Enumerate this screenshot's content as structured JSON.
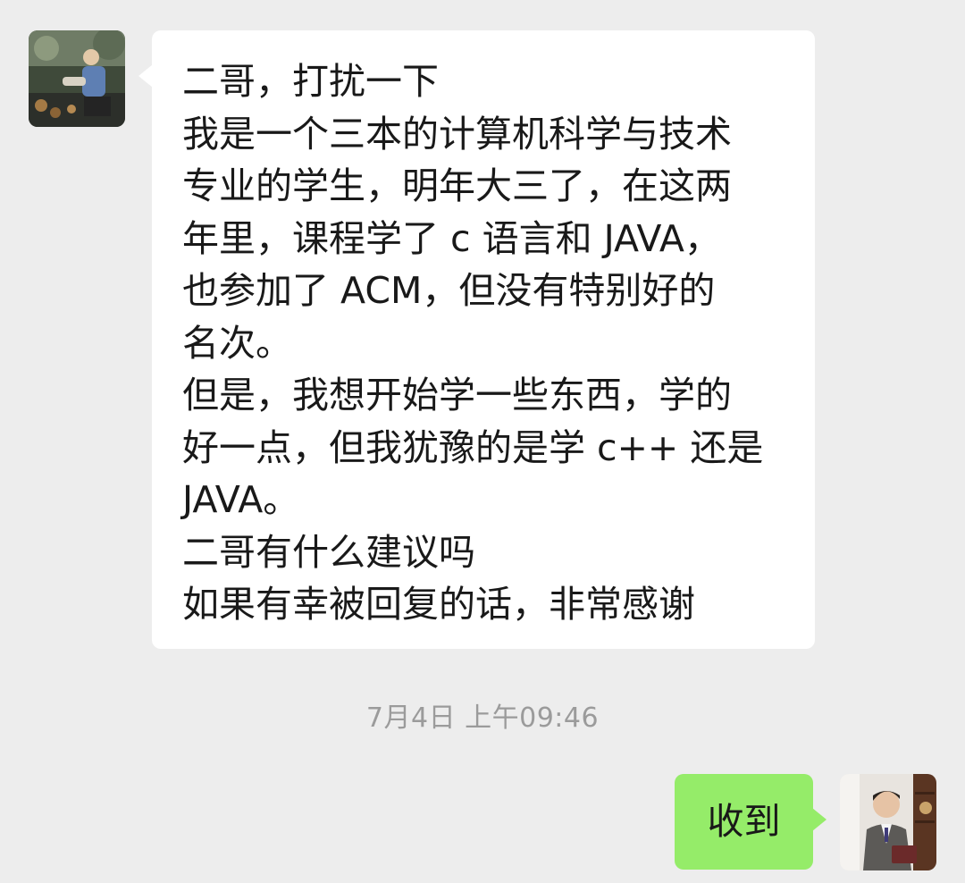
{
  "chat": {
    "incoming": {
      "avatar_icon": "contact-avatar-photo",
      "lines": [
        "二哥，打扰一下",
        "我是一个三本的计算机科学与技术",
        "专业的学生，明年大三了，在这两",
        "年里，课程学了 c 语言和 JAVA，",
        "也参加了 ACM，但没有特别好的",
        "名次。",
        "但是，我想开始学一些东西，学的",
        "好一点，但我犹豫的是学 c++ 还是",
        "JAVA。",
        "二哥有什么建议吗",
        "如果有幸被回复的话，非常感谢"
      ]
    },
    "timestamp": "7月4日 上午09:46",
    "outgoing": {
      "text": "收到",
      "avatar_icon": "own-avatar-photo"
    }
  },
  "colors": {
    "background": "#ededed",
    "incoming_bubble": "#ffffff",
    "outgoing_bubble": "#95ec69",
    "text": "#191919",
    "timestamp": "#9b9b9b"
  }
}
